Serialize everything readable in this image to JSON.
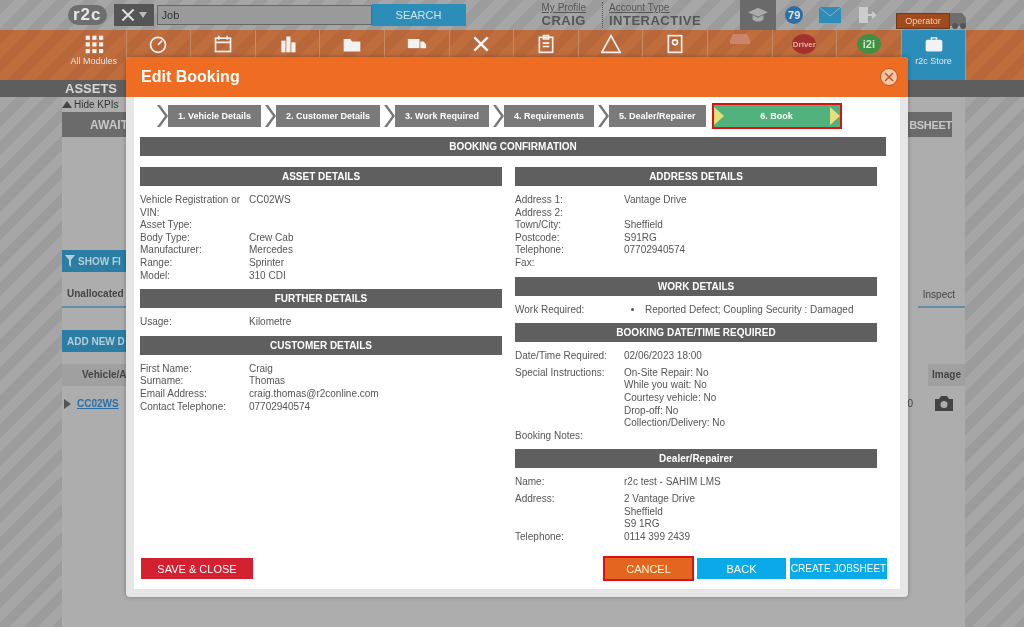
{
  "top_bar": {
    "logo": "r2c",
    "search": {
      "value": "Job"
    },
    "search_button": "SEARCH",
    "profile": {
      "link": "My Profile",
      "name": "CRAIG"
    },
    "account": {
      "link": "Account Type",
      "value": "INTERACTIVE"
    },
    "badge": "79",
    "operator": "Operator"
  },
  "modules": [
    {
      "kind": "grid",
      "label": "All Modules"
    },
    {
      "kind": "gauge"
    },
    {
      "kind": "calendar"
    },
    {
      "kind": "buildings"
    },
    {
      "kind": "folder"
    },
    {
      "kind": "truck"
    },
    {
      "kind": "tools"
    },
    {
      "kind": "clipboard"
    },
    {
      "kind": "warning"
    },
    {
      "kind": "contacts"
    },
    {
      "kind": "dim"
    },
    {
      "kind": "driver",
      "badge_text": "Driver"
    },
    {
      "kind": "i2i",
      "badge_text": "i2i"
    },
    {
      "kind": "store",
      "label": "r2c Store"
    }
  ],
  "page": {
    "title": "ASSETS",
    "hide_kpis": "Hide KPIs",
    "kpi_bar": {
      "column_1": "AWAIT",
      "column_2": "BSHEET"
    },
    "show_filters": "SHOW FI",
    "tabs": [
      {
        "label": "Unallocated"
      },
      {
        "label": "Inspect"
      }
    ],
    "add_button": "ADD NEW D",
    "table": {
      "columns": [
        "Vehicle/A",
        "Image"
      ],
      "rows": [
        {
          "cells": [
            "CC02WS",
            "0"
          ]
        }
      ]
    }
  },
  "modal": {
    "title": "Edit Booking",
    "steps": [
      {
        "label": "1. Vehicle Details",
        "selected": false
      },
      {
        "label": "2. Customer Details",
        "selected": false
      },
      {
        "label": "3. Work Required",
        "selected": false
      },
      {
        "label": "4. Requirements",
        "selected": false
      },
      {
        "label": "5. Dealer/Repairer",
        "selected": false
      },
      {
        "label": "6. Book",
        "selected": true
      }
    ],
    "confirmation_title": "BOOKING CONFIRMATION",
    "left_sections": [
      {
        "title": "ASSET DETAILS",
        "rows": [
          {
            "label": "Vehicle Registration or VIN:",
            "values": [
              "CC02WS"
            ]
          },
          {
            "label": "Asset Type:"
          },
          {
            "label": "Body Type:",
            "values": [
              "Crew Cab"
            ]
          },
          {
            "label": "Manufacturer:",
            "values": [
              "Mercedes"
            ]
          },
          {
            "label": "Range:",
            "values": [
              "Sprinter"
            ]
          },
          {
            "label": "Model:",
            "values": [
              "310 CDI"
            ]
          }
        ]
      },
      {
        "title": "FURTHER DETAILS",
        "rows": [
          {
            "label": "Usage:",
            "values": [
              "Kilometre"
            ]
          }
        ]
      },
      {
        "title": "CUSTOMER DETAILS",
        "rows": [
          {
            "label": "First Name:",
            "values": [
              "Craig"
            ]
          },
          {
            "label": "Surname:",
            "values": [
              "Thomas"
            ]
          },
          {
            "label": "Email Address:",
            "values": [
              "craig.thomas@r2conline.com"
            ]
          },
          {
            "label": "Contact Telephone:",
            "values": [
              "07702940574"
            ]
          }
        ]
      }
    ],
    "right_sections": [
      {
        "title": "ADDRESS DETAILS",
        "rows": [
          {
            "label": "Address 1:",
            "values": [
              "Vantage Drive"
            ]
          },
          {
            "label": "Address 2:"
          },
          {
            "label": "Town/City:",
            "values": [
              "Sheffield"
            ]
          },
          {
            "label": "Postcode:",
            "values": [
              "S91RG"
            ]
          },
          {
            "label": "Telephone:",
            "values": [
              "07702940574"
            ]
          },
          {
            "label": "Fax:"
          }
        ]
      },
      {
        "title": "WORK DETAILS",
        "rows": [
          {
            "label": "Work Required:",
            "bullets": [
              "Reported Defect; Coupling Security : Damaged"
            ]
          }
        ]
      },
      {
        "title": "BOOKING DATE/TIME REQUIRED",
        "rows": [
          {
            "label": "Date/Time Required:",
            "values": [
              "02/06/2023 18:00"
            ]
          },
          {
            "label": "Special Instructions:",
            "values": [
              "On-Site Repair: No",
              "While you wait: No",
              "Courtesy vehicle: No",
              "Drop-off: No",
              "Collection/Delivery: No"
            ]
          },
          {
            "label": "Booking Notes:"
          }
        ]
      },
      {
        "title": "Dealer/Repairer",
        "rows": [
          {
            "label": "Name:",
            "values": [
              "r2c test - SAHIM LMS"
            ]
          },
          {
            "label": "Address:",
            "values": [
              "2 Vantage Drive",
              "Sheffield",
              "S9 1RG"
            ]
          },
          {
            "label": "Telephone:",
            "values": [
              "0114 399 2439"
            ]
          }
        ]
      }
    ],
    "buttons": [
      {
        "kind": "save",
        "label": "SAVE & CLOSE",
        "highlighted": false
      },
      {
        "kind": "cancel",
        "label": "CANCEL",
        "highlighted": true
      },
      {
        "kind": "back",
        "label": "BACK",
        "highlighted": false
      },
      {
        "kind": "create",
        "label": "CREATE JOBSHEET",
        "highlighted": false
      }
    ]
  }
}
